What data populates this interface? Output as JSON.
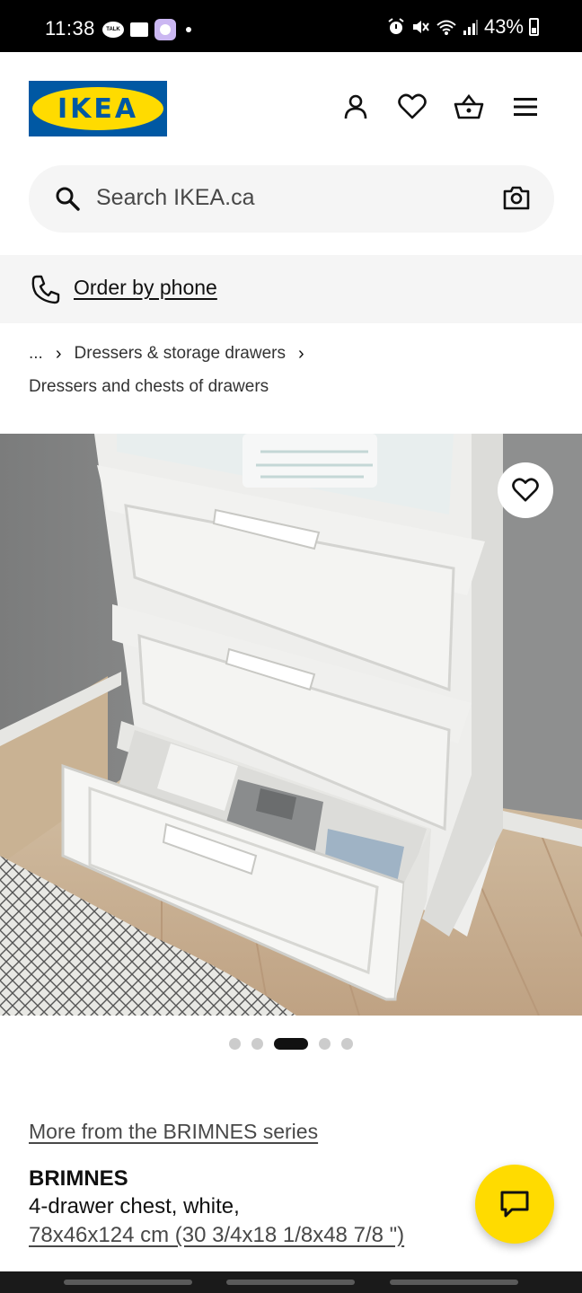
{
  "status_bar": {
    "time": "11:38",
    "talk_icon_text": "TALK",
    "battery": "43%",
    "icons": [
      "talk-icon",
      "folder-icon",
      "app-icon",
      "dot-icon",
      "alarm-icon",
      "mute-icon",
      "wifi-icon",
      "signal-icon",
      "battery-icon"
    ]
  },
  "header": {
    "logo_text": "IKEA",
    "icons": [
      "account-icon",
      "heart-icon",
      "basket-icon",
      "menu-icon"
    ]
  },
  "search": {
    "placeholder": "Search IKEA.ca"
  },
  "phone_bar": {
    "label": "Order by phone"
  },
  "breadcrumb": {
    "ellipsis": "...",
    "chevron": "›",
    "parent": "Dressers & storage drawers",
    "current": "Dressers and chests of drawers"
  },
  "gallery": {
    "image_count": 5,
    "active_index": 3
  },
  "product": {
    "series_link": "More from the BRIMNES series",
    "name": "BRIMNES",
    "description": "4-drawer chest, white,",
    "dimensions": "78x46x124 cm (30 3/4x18 1/8x48 7/8 \")"
  },
  "colors": {
    "ikea_blue": "#0058a3",
    "ikea_yellow": "#ffdb00",
    "text": "#111111",
    "light_bg": "#f5f5f5"
  }
}
